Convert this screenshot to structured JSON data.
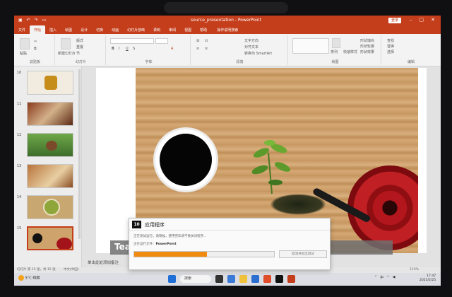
{
  "window": {
    "title": "source_presentation - PowerPoint",
    "signin": "登录"
  },
  "tabs": [
    "文件",
    "开始",
    "插入",
    "绘图",
    "设计",
    "切换",
    "动画",
    "幻灯片放映",
    "录制",
    "审阅",
    "视图",
    "帮助"
  ],
  "tell_me": "操作说明搜索",
  "ribbon": {
    "clipboard_group": "剪贴板",
    "slides_group": "幻灯片",
    "font_group": "字体",
    "paragraph_group": "段落",
    "drawing_group": "绘图",
    "editing_group": "编辑",
    "new_slide": "新建幻灯片",
    "paste": "粘贴",
    "layout": "版式",
    "reset": "重置",
    "section": "节",
    "text_direction": "文字方向",
    "align_text": "对齐文本",
    "smartart": "转换为 SmartArt",
    "find": "查找",
    "replace": "替换",
    "select": "选择",
    "arrange": "排列",
    "quick_styles": "快速样式",
    "fill": "形状填充",
    "outline": "形状轮廓",
    "effects": "形状效果"
  },
  "slides": [
    {
      "num": "10",
      "thumb": "tea-bowl"
    },
    {
      "num": "11",
      "thumb": "tea-set-tray"
    },
    {
      "num": "12",
      "thumb": "teapot-garden"
    },
    {
      "num": "13",
      "thumb": "tea-cups"
    },
    {
      "num": "14",
      "thumb": "matcha-bowls"
    },
    {
      "num": "15",
      "thumb": "teacup-red-pot",
      "selected": true
    }
  ],
  "slide_title": "Tea",
  "notes_placeholder": "单击此处添加备注",
  "status": {
    "left": "幻灯片 第 15 张，共 15 张",
    "lang": "中文(中国)",
    "zoom": "110%"
  },
  "dialog": {
    "logo": "10",
    "title": "应用程序",
    "message": "正在测试运行，请稍候，使用完毕请不要关闭程序...",
    "file_label": "正在运行文件：",
    "file_value": "PowerPoint",
    "progress": 0.52,
    "button": "取消并退出测试"
  },
  "taskbar": {
    "weather_temp": "5°C",
    "weather_desc": "晴朗",
    "search": "搜索",
    "input_lang": "中",
    "time": "17:47",
    "date": "2023/2/25"
  }
}
